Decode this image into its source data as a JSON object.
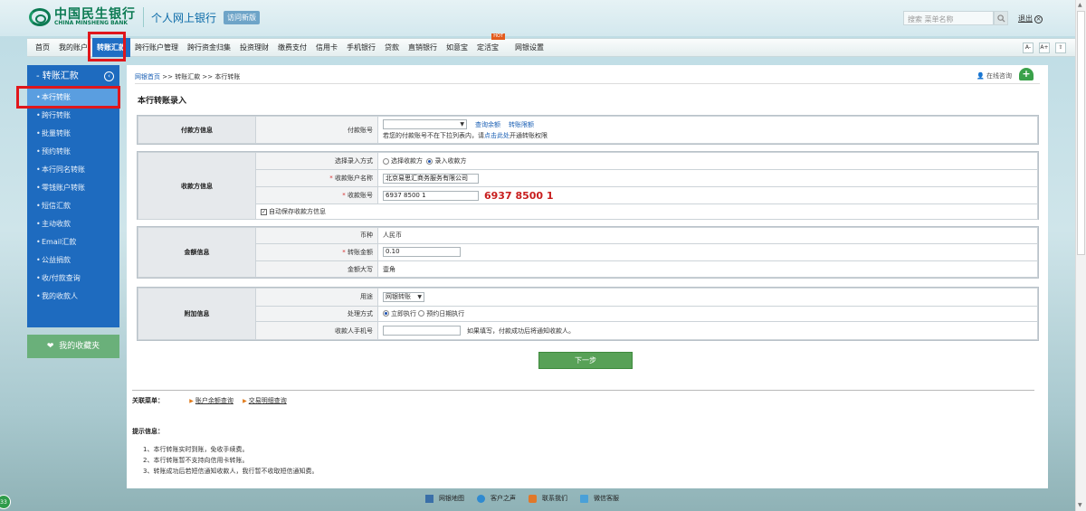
{
  "header": {
    "logo_cn": "中国民生银行",
    "logo_en": "CHINA MINSHENG BANK",
    "site_name": "个人网上银行",
    "visit_label": "访问新版",
    "search_placeholder": "搜索 菜单名称",
    "logout_label": "退出"
  },
  "nav": {
    "items": [
      "首页",
      "我的账户",
      "转账汇款",
      "跨行账户管理",
      "跨行资金归集",
      "投资理财",
      "缴费支付",
      "信用卡",
      "手机银行",
      "贷款",
      "直销银行",
      "如意宝",
      "定活宝",
      "网银设置"
    ],
    "active_index": 2,
    "hot_label": "HOT",
    "font_smaller": "A-",
    "font_larger": "A+"
  },
  "sidebar": {
    "title": "转账汇款",
    "items": [
      "本行转账",
      "跨行转账",
      "批量转账",
      "预约转账",
      "本行同名转账",
      "零钱账户转账",
      "短信汇款",
      "主动收款",
      "Email汇款",
      "公益捐款",
      "收/付款查询",
      "我的收款人"
    ],
    "active_index": 0,
    "favorites": "我的收藏夹"
  },
  "breadcrumb": {
    "home": "网银首页",
    "rest": ">> 转账汇款 >> 本行转账"
  },
  "consult_label": "在线咨询",
  "page_title": "本行转账录入",
  "payer": {
    "head": "付款方信息",
    "account_label": "付款账号",
    "account_value": "",
    "check_balance": "查询余额",
    "transfer_limit": "转账限额",
    "note_before": "若您的付款账号不在下拉列表内，请",
    "note_link": "点击此处",
    "note_after": "开通转账权限"
  },
  "payee": {
    "head": "收款方信息",
    "method_label": "选择录入方式",
    "option_select": "选择收款方",
    "option_enter": "录入收款方",
    "selected": "录入收款方",
    "name_label": "收款账户名称",
    "name_value": "北京易思汇商务服务有限公司",
    "account_label": "收款账号",
    "account_value": "6937 8500 1",
    "account_display": "6937 8500 1",
    "autosave_label": "自动保存收款方信息",
    "autosave_checked": true
  },
  "amount": {
    "head": "金额信息",
    "currency_label": "币种",
    "currency_value": "人民币",
    "amount_label": "转账金额",
    "amount_value": "0.10",
    "upper_label": "金额大写",
    "upper_value": "壹角"
  },
  "extra": {
    "head": "附加信息",
    "purpose_label": "用途",
    "purpose_value": "网银转账",
    "mode_label": "处理方式",
    "mode_now": "立即执行",
    "mode_scheduled": "预约日期执行",
    "mode_selected": "立即执行",
    "phone_label": "收款人手机号",
    "phone_value": "",
    "phone_note": "如果填写，付款成功后将通知收款人。"
  },
  "next_button": "下一步",
  "related": {
    "title": "关联菜单：",
    "links": [
      "账户余额查询",
      "交易明细查询"
    ]
  },
  "tips": {
    "title": "提示信息：",
    "items": [
      "1、本行转账实时到账，免收手续费。",
      "2、本行转账暂不支持向信用卡转账。",
      "3、转账成功后若短信通知收款人，我行暂不收取短信通知费。"
    ]
  },
  "footer": [
    "网银地图",
    "客户之声",
    "联系我们",
    "微信客服"
  ],
  "corner_badge": "33",
  "colors": {
    "nav_active": "#1f6ec4",
    "sidebar": "#1e6bbf",
    "highlight": "#e0161b",
    "next_button": "#58a157",
    "account_red": "#c81e1e"
  }
}
